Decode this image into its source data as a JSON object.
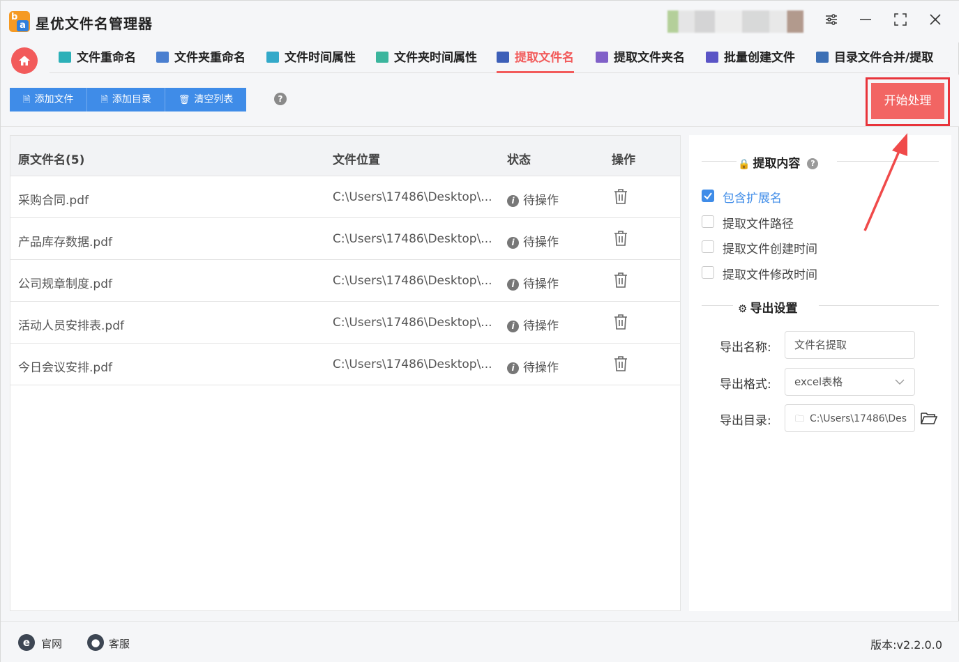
{
  "app": {
    "title": "星优文件名管理器",
    "logo_letters": [
      "b",
      "a"
    ]
  },
  "window_controls": {
    "settings": "⚙",
    "minimize": "—",
    "maximize": "⛶",
    "close": "✕"
  },
  "tabs": [
    {
      "label": "文件重命名",
      "icon": "rename-file-icon",
      "color": "#2bb0b8"
    },
    {
      "label": "文件夹重命名",
      "icon": "rename-folder-icon",
      "color": "#4a7fd0"
    },
    {
      "label": "文件时间属性",
      "icon": "file-time-icon",
      "color": "#33a9c9"
    },
    {
      "label": "文件夹时间属性",
      "icon": "folder-time-icon",
      "color": "#3bb59d"
    },
    {
      "label": "提取文件名",
      "icon": "extract-filename-icon",
      "color": "#3d5fb8"
    },
    {
      "label": "提取文件夹名",
      "icon": "extract-foldername-icon",
      "color": "#8060c8"
    },
    {
      "label": "批量创建文件",
      "icon": "batch-create-icon",
      "color": "#5a54c6"
    },
    {
      "label": "目录文件合并/提取",
      "icon": "merge-extract-icon",
      "color": "#3c6fb5"
    }
  ],
  "active_tab": "提取文件名",
  "toolbar": {
    "add_file": "添加文件",
    "add_dir": "添加目录",
    "clear_list": "清空列表",
    "help": "?",
    "start": "开始处理"
  },
  "table": {
    "headers": {
      "name": "原文件名(5)",
      "location": "文件位置",
      "status": "状态",
      "action": "操作"
    },
    "rows": [
      {
        "name": "采购合同.pdf",
        "location": "C:\\Users\\17486\\Desktop\\...",
        "status": "待操作"
      },
      {
        "name": "产品库存数据.pdf",
        "location": "C:\\Users\\17486\\Desktop\\...",
        "status": "待操作"
      },
      {
        "name": "公司规章制度.pdf",
        "location": "C:\\Users\\17486\\Desktop\\...",
        "status": "待操作"
      },
      {
        "name": "活动人员安排表.pdf",
        "location": "C:\\Users\\17486\\Desktop\\...",
        "status": "待操作"
      },
      {
        "name": "今日会议安排.pdf",
        "location": "C:\\Users\\17486\\Desktop\\...",
        "status": "待操作"
      }
    ]
  },
  "settings": {
    "extract_title": "提取内容",
    "options": [
      {
        "label": "包含扩展名",
        "checked": true
      },
      {
        "label": "提取文件路径",
        "checked": false
      },
      {
        "label": "提取文件创建时间",
        "checked": false
      },
      {
        "label": "提取文件修改时间",
        "checked": false
      }
    ],
    "export_title": "导出设置",
    "export_name_label": "导出名称:",
    "export_name_value": "文件名提取",
    "export_format_label": "导出格式:",
    "export_format_value": "excel表格",
    "export_dir_label": "导出目录:",
    "export_dir_value": "C:\\Users\\17486\\Des"
  },
  "footer": {
    "website": "官网",
    "service": "客服",
    "version": "版本:v2.2.0.0"
  },
  "colors": {
    "accent_blue": "#3f8ce8",
    "accent_red": "#f25b5b",
    "highlight_border": "#e8343b"
  }
}
